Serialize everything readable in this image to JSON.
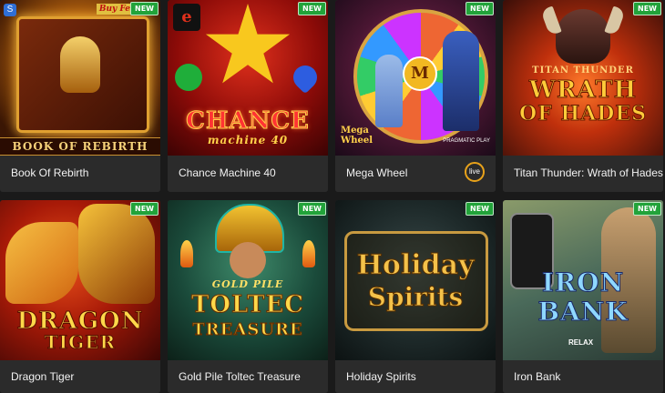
{
  "badges": {
    "new": "NEW",
    "live": "live"
  },
  "games": [
    {
      "title": "Book Of Rebirth",
      "art_text": "BOOK OF REBIRTH",
      "corner_text": "Buy Fe",
      "new": true
    },
    {
      "title": "Chance Machine 40",
      "art_text": "CHANCE",
      "art_sub": "machine 40",
      "new": true
    },
    {
      "title": "Mega Wheel",
      "art_text": "Mega Wheel",
      "provider": "PRAGMATIC PLAY",
      "new": true,
      "live": true
    },
    {
      "title": "Titan Thunder: Wrath of Hades",
      "art_text_top": "TITAN THUNDER",
      "art_text": "WRATH",
      "art_text_bottom": "OF HADES",
      "new": true
    },
    {
      "title": "Dragon Tiger",
      "art_text": "DRAGON",
      "art_text_bottom": "TIGER",
      "new": true
    },
    {
      "title": "Gold Pile Toltec Treasure",
      "art_text_top": "GOLD PILE",
      "art_text": "TOLTEC",
      "art_text_bottom": "TREASURE",
      "new": true
    },
    {
      "title": "Holiday Spirits",
      "art_text": "Holiday",
      "art_text_bottom": "Spirits",
      "new": true
    },
    {
      "title": "Iron Bank",
      "art_text": "IRON",
      "art_text_bottom": "BANK",
      "provider": "RELAX",
      "new": true
    }
  ]
}
